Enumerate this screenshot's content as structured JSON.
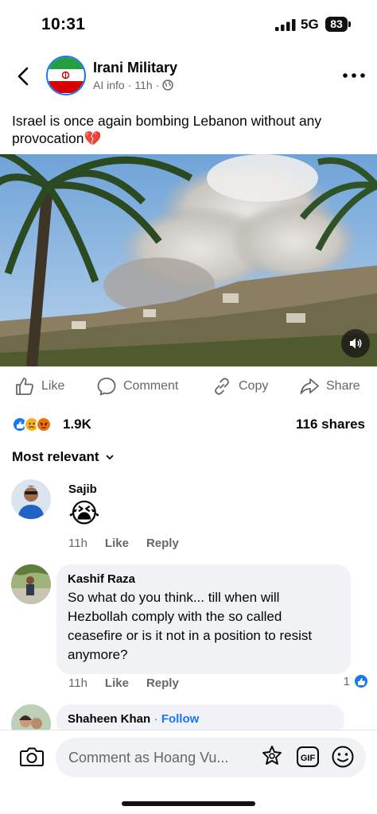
{
  "status_bar": {
    "time": "10:31",
    "network": "5G",
    "battery": "83"
  },
  "post": {
    "page_name": "Irani Military",
    "meta_label": "AI info",
    "time": "11h",
    "text": "Israel is once again bombing Lebanon without any provocation",
    "text_emoji": "💔"
  },
  "actions": {
    "like": "Like",
    "comment": "Comment",
    "copy": "Copy",
    "share": "Share"
  },
  "reactions": {
    "count": "1.9K",
    "shares": "116 shares",
    "types": [
      "like",
      "sad",
      "angry"
    ]
  },
  "sort_label": "Most relevant",
  "comments": [
    {
      "name": "Sajib",
      "text": "😭",
      "time": "11h",
      "like_label": "Like",
      "reply_label": "Reply"
    },
    {
      "name": "Kashif Raza",
      "text": "So what do you think... till when will Hezbollah comply with the so called ceasefire or is it not in a position to resist anymore?",
      "time": "11h",
      "like_label": "Like",
      "reply_label": "Reply",
      "likes": "1"
    },
    {
      "name": "Shaheen Khan",
      "follow_label": "Follow"
    }
  ],
  "composer": {
    "placeholder": "Comment as Hoang Vu..."
  },
  "colors": {
    "accent": "#1877f2",
    "muted": "#65676b",
    "bubble": "#f0f2f5"
  },
  "icons": [
    "back-icon",
    "more-icon",
    "globe-icon",
    "volume-icon",
    "like-icon",
    "comment-icon",
    "copy-icon",
    "share-icon",
    "chevron-down-icon",
    "camera-icon",
    "avatar-sticker-icon",
    "gif-icon",
    "emoji-icon"
  ]
}
